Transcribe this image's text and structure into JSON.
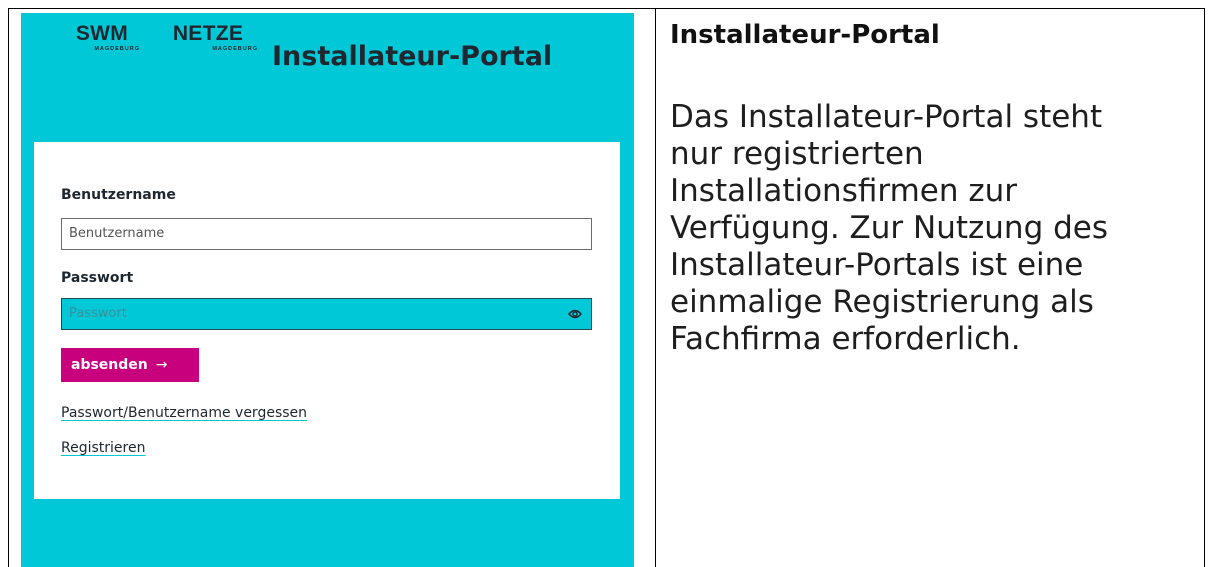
{
  "logos": {
    "swm": {
      "main": "SWM",
      "sub": "MAGDEBURG"
    },
    "netze": {
      "main": "NETZE",
      "sub": "MAGDEBURG"
    }
  },
  "portal": {
    "title": "Installateur-Portal"
  },
  "login": {
    "username_label": "Benutzername",
    "username_placeholder": "Benutzername",
    "password_label": "Passwort",
    "password_placeholder": "Passwort",
    "password_toggle_icon": "eye-icon",
    "submit_label": "absenden",
    "submit_icon": "→",
    "forgot_link": "Passwort/Benutzername vergessen",
    "register_link": "Registrieren"
  },
  "info": {
    "heading": "Installateur-Portal",
    "text": "Das Installateur-Portal steht\nnur registrierten\nInstallationsfirmen zur\nVerfügung. Zur Nutzung des\nInstallateur-Portals ist eine\neinmalige Registrierung als\nFachfirma erforderlich."
  },
  "colors": {
    "panel_background": "#00c8d7",
    "submit_button": "#c8007e",
    "text_dark": "#1e2730"
  }
}
